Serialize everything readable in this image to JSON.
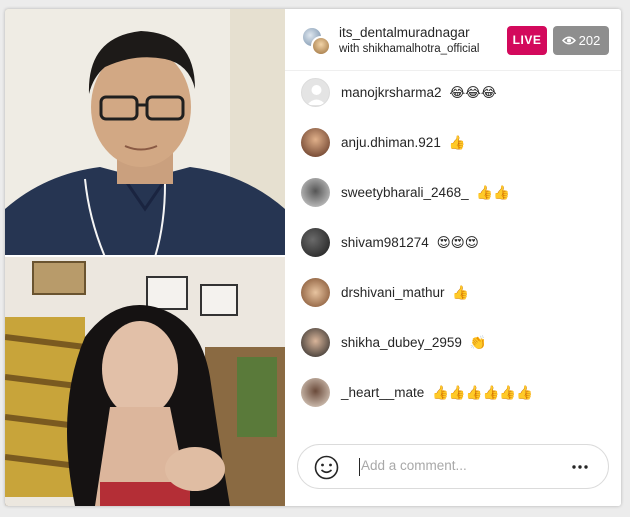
{
  "header": {
    "host_username": "its_dentalmuradnagar",
    "with_text": "with shikhamalhotra_official",
    "live_label": "LIVE",
    "viewer_count": "202"
  },
  "comments": [
    {
      "username": "manojkrsharma2",
      "emoji": "😂😂😂",
      "avatar_color": "#e0e0e0"
    },
    {
      "username": "anju.dhiman.921",
      "emoji": "👍",
      "avatar_color": "#6a3d2a"
    },
    {
      "username": "sweetybharali_2468_",
      "emoji": "👍👍",
      "avatar_color": "#cfcfcf"
    },
    {
      "username": "shivam981274",
      "emoji": "😍😍😍",
      "avatar_color": "#2a2a2a"
    },
    {
      "username": "drshivani_mathur",
      "emoji": "👍",
      "avatar_color": "#b07a4f"
    },
    {
      "username": "shikha_dubey_2959",
      "emoji": "👏",
      "avatar_color": "#3b3b3b"
    },
    {
      "username": "_heart__mate",
      "emoji": "👍👍👍👍👍👍",
      "avatar_color": "#c9b8a8"
    }
  ],
  "input": {
    "placeholder": "Add a comment..."
  },
  "colors": {
    "live": "#d3095c",
    "viewer_badge": "#8e8e8e",
    "text": "#262626"
  },
  "icons": {
    "smiley": "smiley-icon",
    "more": "more-options-icon",
    "eye": "eye-icon"
  }
}
